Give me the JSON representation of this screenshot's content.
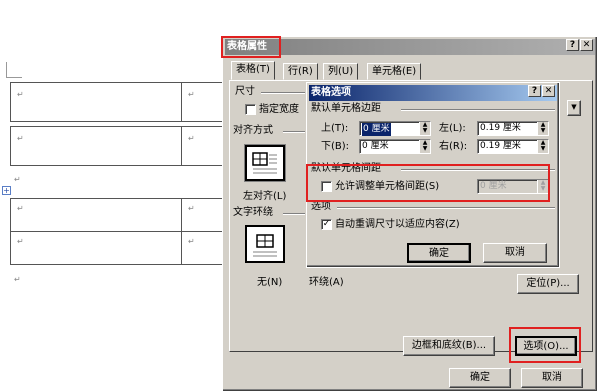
{
  "document": {
    "para_mark": "↵"
  },
  "outer_dialog": {
    "title": "表格属性",
    "help": "?",
    "close": "✕",
    "tabs": [
      "表格(T)",
      "行(R)",
      "列(U)",
      "单元格(E)"
    ],
    "size_group": "尺寸",
    "preferred_width": "指定宽度",
    "align_group": "对齐方式",
    "align_left": "左对齐(L)",
    "wrap_group": "文字环绕",
    "wrap_none": "无(N)",
    "wrap_around": "环绕(A)",
    "position_button": "定位(P)...",
    "borders_button": "边框和底纹(B)...",
    "options_button": "选项(O)...",
    "ok_button": "确定",
    "cancel_button": "取消"
  },
  "inner_dialog": {
    "title": "表格选项",
    "help": "?",
    "close": "✕",
    "margins_group": "默认单元格边距",
    "top_label": "上(T):",
    "top_value": "0 厘米",
    "left_label": "左(L):",
    "left_value": "0.19 厘米",
    "bottom_label": "下(B):",
    "bottom_value": "0 厘米",
    "right_label": "右(R):",
    "right_value": "0.19 厘米",
    "spacing_group": "默认单元格间距",
    "allow_spacing": "允许调整单元格间距(S)",
    "spacing_value": "0 厘米",
    "options_group": "选项",
    "autofit": "自动重调尺寸以适应内容(Z)",
    "ok_button": "确定",
    "cancel_button": "取消"
  }
}
